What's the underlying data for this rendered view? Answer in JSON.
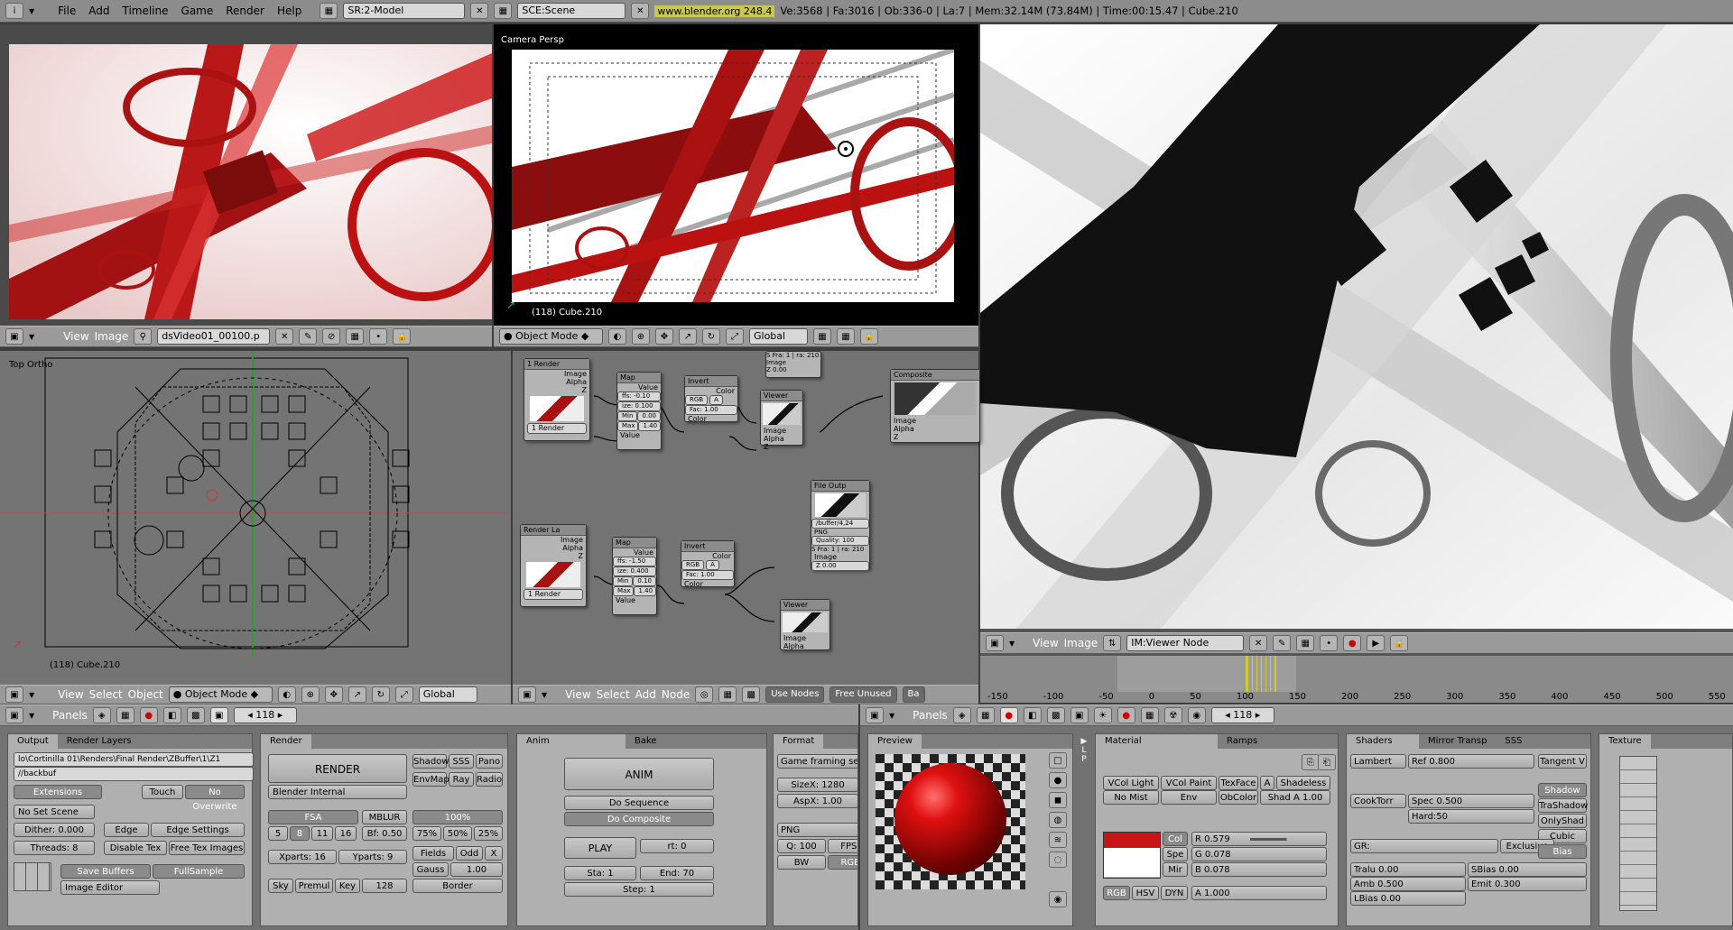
{
  "topbar": {
    "menu": [
      "File",
      "Add",
      "Timeline",
      "Game",
      "Render",
      "Help"
    ],
    "screen": "SR:2-Model",
    "scene": "SCE:Scene",
    "version": "www.blender.org 248.4",
    "stats": "Ve:3568 | Fa:3016 | Ob:336-0 | La:7  | Mem:32.14M (73.84M)  | Time:00:15.47 | Cube.210"
  },
  "image_editor_1": {
    "view": "View",
    "image": "Image",
    "file": "dsVideo01_00100.p"
  },
  "camera_view": {
    "title": "Camera Persp",
    "object": "(118) Cube.210",
    "mode": "Object Mode",
    "orientation": "Global"
  },
  "top_view": {
    "title": "Top Ortho",
    "object": "(118) Cube.210",
    "menu": [
      "View",
      "Select",
      "Object"
    ],
    "mode": "Object Mode",
    "orientation": "Global"
  },
  "node_editor": {
    "menu": [
      "View",
      "Select",
      "Add",
      "Node"
    ],
    "use_nodes": "Use Nodes",
    "free_unused": "Free Unused",
    "ba": "Ba",
    "nodes": {
      "render1": "1 Render",
      "image": "Image",
      "alpha": "Alpha",
      "z": "Z",
      "render1_sel": "1 Render",
      "map1": "Map",
      "value": "Value",
      "ofs1": "ffs: -0.10",
      "size1": "ize: 0.100",
      "min": "Min",
      "min_val": "0.00",
      "max": "Max",
      "max_val": "1.40",
      "invert1": "Invert",
      "color": "Color",
      "rgb": "RGB",
      "a": "A",
      "fac": "Fac: 1.00",
      "viewer1": "Viewer",
      "composite": "Composite",
      "sfra": "S Fra: 1 | ra: 210",
      "z0": "Z 0.00",
      "fileout": "File Outp",
      "file_path": "/buffer/4,24",
      "png": "PNG",
      "quality": "Quality: 100",
      "sfra2": "S Fra: 1 | ra: 210",
      "renderla": "Render La",
      "renderla_sel": "1 Render",
      "map2": "Map",
      "ofs2": "ffs: -1.50",
      "size2": "ize: 0.400",
      "min_val2": "0.10",
      "invert2": "Invert",
      "viewer2": "Viewer"
    }
  },
  "image_editor_2": {
    "view": "View",
    "image": "Image",
    "file": "IM:Viewer Node"
  },
  "timeline": {
    "ticks": [
      "-150",
      "-100",
      "-50",
      "0",
      "50",
      "100",
      "150",
      "200",
      "250",
      "300",
      "350",
      "400",
      "450",
      "500",
      "550"
    ]
  },
  "buttons_left": {
    "panels": "Panels",
    "frame": "118",
    "output": {
      "tab1": "Output",
      "tab2": "Render Layers",
      "path1": "lo\\Cortinilla 01\\Renders\\Final Render\\ZBuffer\\1\\Z1",
      "path2": "//backbuf",
      "extensions": "Extensions",
      "touch": "Touch",
      "no_overwrite": "No Overwrite",
      "no_set_scene": "No Set Scene",
      "dither": "Dither: 0.000",
      "edge": "Edge",
      "edge_settings": "Edge Settings",
      "threads": "Threads: 8",
      "disable_tex": "Disable Tex",
      "free_tex": "Free Tex Images",
      "save_buffers": "Save Buffers",
      "full_sample": "FullSample",
      "image_editor": "Image Editor"
    },
    "render": {
      "tab": "Render",
      "render_btn": "RENDER",
      "engine": "Blender Internal",
      "shadow": "Shadow",
      "sss": "SSS",
      "pano": "Pano",
      "envmap": "EnvMap",
      "ray": "Ray",
      "radio": "Radio",
      "fsa": "FSA",
      "mblur": "MBLUR",
      "pct100": "100%",
      "s5": "5",
      "s8": "8",
      "s11": "11",
      "s16": "16",
      "bf": "Bf: 0.50",
      "pct75": "75%",
      "pct50": "50%",
      "pct25": "25%",
      "xparts": "Xparts: 16",
      "yparts": "Yparts: 9",
      "fields": "Fields",
      "odd": "Odd",
      "x": "X",
      "gauss": "Gauss",
      "gauss_val": "1.00",
      "sky": "Sky",
      "premul": "Premul",
      "key": "Key",
      "b128": "128",
      "border": "Border"
    },
    "anim": {
      "tab1": "Anim",
      "tab2": "Bake",
      "anim_btn": "ANIM",
      "do_sequence": "Do Sequence",
      "do_composite": "Do Composite",
      "play": "PLAY",
      "rt": "rt: 0",
      "sta": "Sta: 1",
      "end": "End: 70",
      "step": "Step: 1"
    },
    "format": {
      "tab": "Format",
      "preset": "Game framing setti",
      "sizex": "SizeX: 1280",
      "aspx": "AspX: 1.00",
      "png": "PNG",
      "q": "Q: 100",
      "fps": "FPS:",
      "bw": "BW",
      "rgb": "RGE"
    }
  },
  "buttons_right": {
    "panels": "Panels",
    "frame": "118",
    "preview": "Preview",
    "material": {
      "tab1": "Material",
      "tab2": "Ramps",
      "vcol_light": "VCol Light",
      "vcol_paint": "VCol Paint",
      "texface": "TexFace",
      "a": "A",
      "shadeless": "Shadeless",
      "no_mist": "No Mist",
      "env": "Env",
      "obcolor": "ObColor",
      "shad_a": "Shad A 1.00",
      "col": "Col",
      "spe": "Spe",
      "mir": "Mir",
      "r": "R 0.579",
      "g": "G 0.078",
      "b": "B 0.078",
      "alpha": "A 1.000",
      "rgb": "RGB",
      "hsv": "HSV",
      "dyn": "DYN"
    },
    "shaders": {
      "tab1": "Shaders",
      "tab2": "Mirror Transp",
      "tab3": "SSS",
      "lambert": "Lambert",
      "ref": "Ref  0.800",
      "tangent": "Tangent V",
      "shadow": "Shadow",
      "trashadow": "TraShadow",
      "cooktorr": "CookTorr",
      "spec": "Spec 0.500",
      "hard": "Hard:50",
      "onlyshad": "OnlyShad",
      "cubic": "Cubic",
      "gr": "GR:",
      "exclusive": "Exclusive",
      "bias": "Bias",
      "tralu": "Tralu 0.00",
      "sbias": "SBias 0.00",
      "amb": "Amb 0.500",
      "emit": "Emit 0.300",
      "lbias": "LBias 0.00"
    },
    "texture": "Texture"
  },
  "colors": {
    "accent": "#c81515",
    "header": "#9a9a9a",
    "panel": "#b0b0b0",
    "material": "#c81515"
  }
}
